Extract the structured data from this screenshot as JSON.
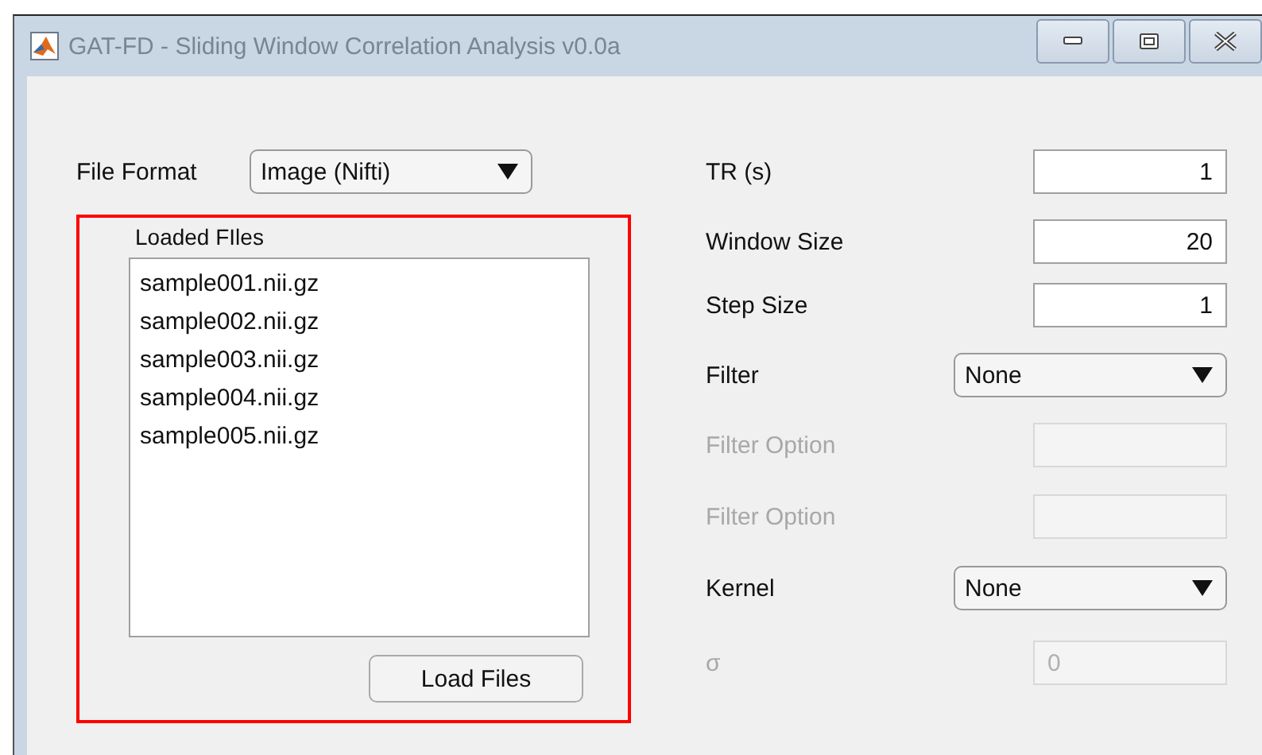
{
  "window": {
    "title": "GAT-FD - Sliding Window Correlation Analysis v0.0a"
  },
  "file_format": {
    "label": "File Format",
    "value": "Image (Nifti)"
  },
  "loaded_files": {
    "title": "Loaded FIles",
    "files": [
      "sample001.nii.gz",
      "sample002.nii.gz",
      "sample003.nii.gz",
      "sample004.nii.gz",
      "sample005.nii.gz"
    ],
    "button": "Load Files",
    "highlighted": true
  },
  "parameters": [
    {
      "kind": "input",
      "label": "TR (s)",
      "value": "1",
      "disabled": false
    },
    {
      "kind": "input",
      "label": "Window Size",
      "value": "20",
      "disabled": false
    },
    {
      "kind": "input",
      "label": "Step Size",
      "value": "1",
      "disabled": false
    },
    {
      "kind": "dropdown",
      "label": "Filter",
      "value": "None",
      "disabled": false
    },
    {
      "kind": "input",
      "label": "Filter Option",
      "disabled": true
    },
    {
      "kind": "input",
      "label": "Filter Option",
      "disabled": true
    },
    {
      "kind": "dropdown",
      "label": "Kernel",
      "value": "None",
      "disabled": false
    },
    {
      "kind": "input",
      "label": "σ",
      "value": "0",
      "disabled": true
    }
  ]
}
